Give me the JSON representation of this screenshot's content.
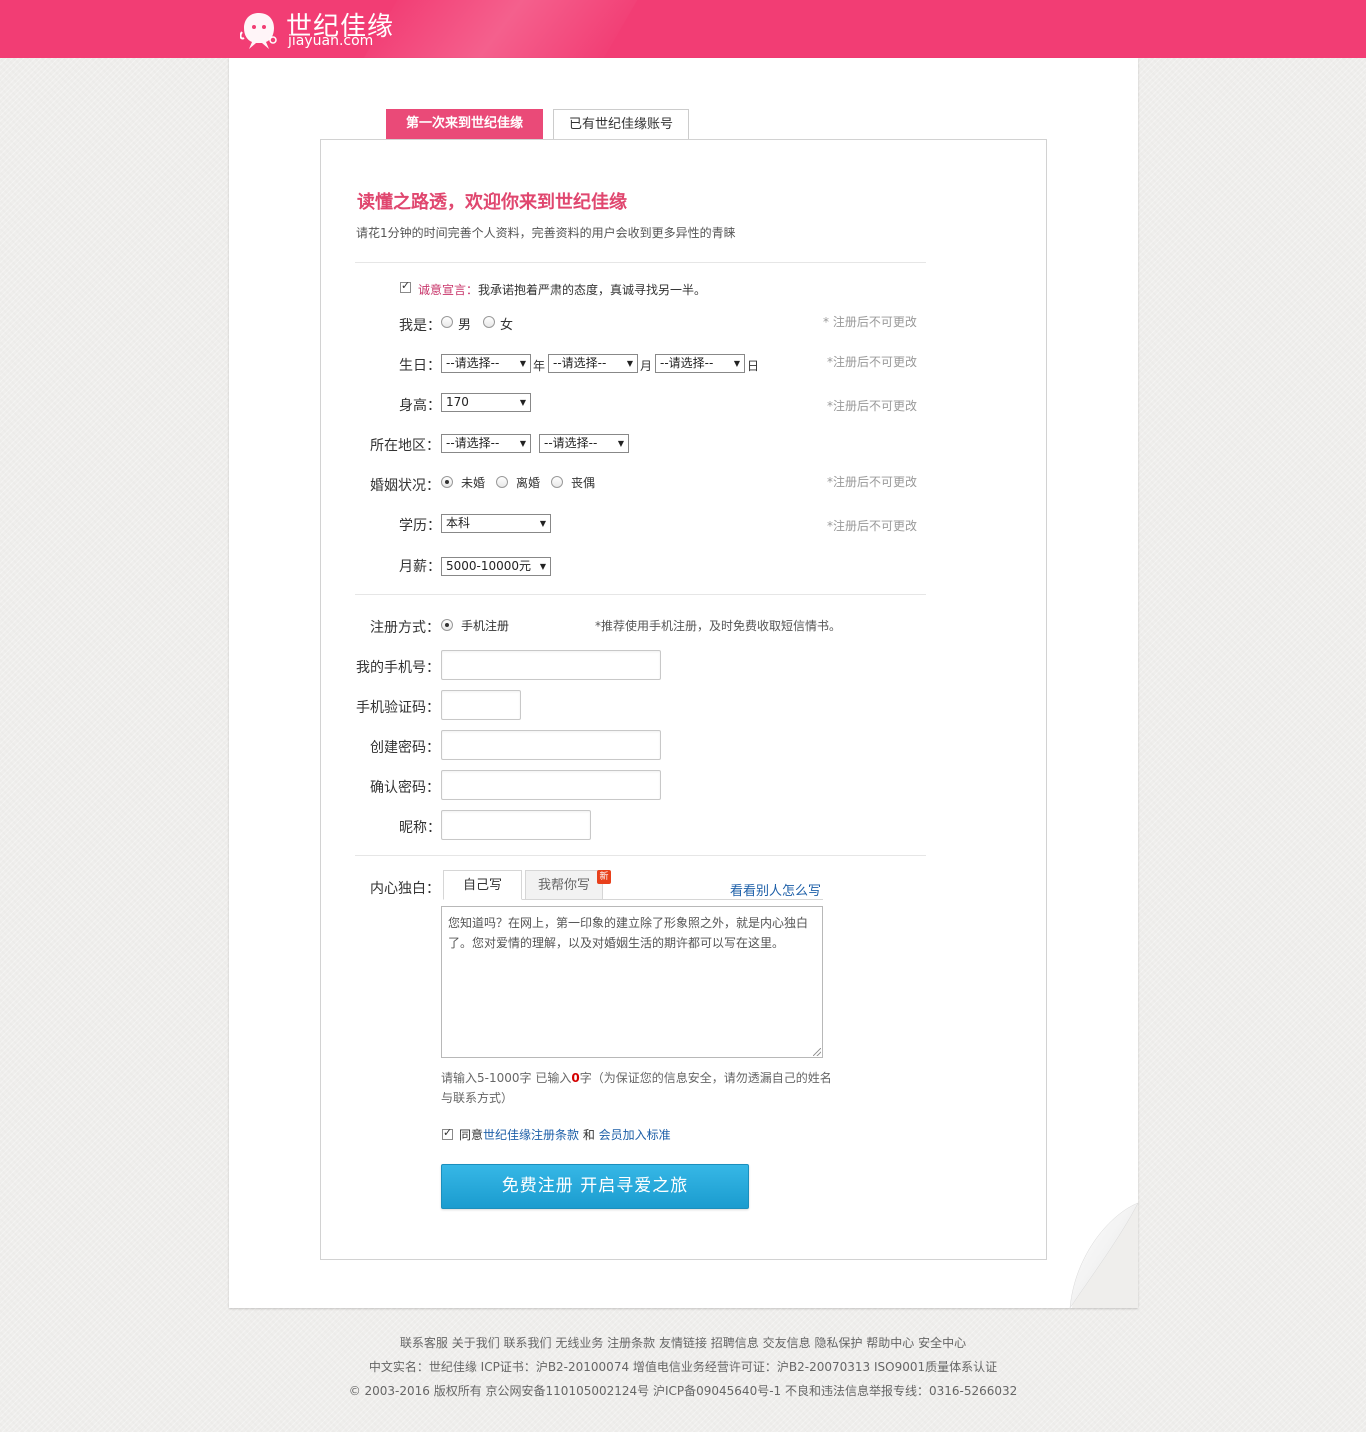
{
  "header": {
    "brand_cn": "世纪佳缘",
    "brand_en": "jiayuan.com",
    "colors": {
      "bar": "#f23d74",
      "accent": "#e0476f",
      "button": "#1b9ccf"
    }
  },
  "tabs": {
    "new_user": "第一次来到世纪佳缘",
    "existing_user": "已有世纪佳缘账号"
  },
  "intro": {
    "welcome": "读懂之路透，欢迎你来到世纪佳缘",
    "subtitle": "请花1分钟的时间完善个人资料，完善资料的用户会收到更多异性的青睐"
  },
  "pledge": {
    "title": "诚意宣言：",
    "text": "我承诺抱着严肃的态度，真诚寻找另一半。",
    "checked": true
  },
  "profile": {
    "gender": {
      "label": "我是：",
      "options": [
        "男",
        "女"
      ],
      "note": "* 注册后不可更改"
    },
    "birthday": {
      "label": "生日：",
      "year_placeholder": "--请选择--",
      "month_placeholder": "--请选择--",
      "day_placeholder": "--请选择--",
      "year_unit": "年",
      "month_unit": "月",
      "day_unit": "日",
      "note": "*注册后不可更改"
    },
    "height": {
      "label": "身高：",
      "value": "170",
      "note": "*注册后不可更改"
    },
    "region": {
      "label": "所在地区：",
      "province": "--请选择--",
      "city": "--请选择--"
    },
    "marriage": {
      "label": "婚姻状况：",
      "options": [
        "未婚",
        "离婚",
        "丧偶"
      ],
      "selected": "未婚",
      "note": "*注册后不可更改"
    },
    "education": {
      "label": "学历：",
      "value": "本科",
      "note": "*注册后不可更改"
    },
    "salary": {
      "label": "月薪：",
      "value": "5000-10000元"
    }
  },
  "account": {
    "method": {
      "label": "注册方式：",
      "option": "手机注册",
      "note": "*推荐使用手机注册，及时免费收取短信情书。"
    },
    "phone_label": "我的手机号：",
    "code_label": "手机验证码：",
    "password_label": "创建密码：",
    "confirm_label": "确认密码：",
    "nickname_label": "昵称："
  },
  "monologue": {
    "label": "内心独白：",
    "tab_self": "自己写",
    "tab_help": "我帮你写",
    "badge": "新",
    "see_others": "看看别人怎么写",
    "placeholder": "您知道吗？在网上，第一印象的建立除了形象照之外，就是内心独白了。您对爱情的理解，以及对婚姻生活的期许都可以写在这里。",
    "hint_prefix": "请输入5-1000字 已输入",
    "count": "0",
    "hint_suffix": "字（为保证您的信息安全，请勿透漏自己的姓名与联系方式）"
  },
  "terms": {
    "prefix": "同意",
    "terms_link": "世纪佳缘注册条款",
    "and": " 和 ",
    "standard_link": "会员加入标准",
    "checked": true
  },
  "submit": {
    "label": "免费注册  开启寻爱之旅"
  },
  "footer": {
    "links": "联系客服 关于我们 联系我们 无线业务 注册条款 友情链接 招聘信息 交友信息 隐私保护 帮助中心 安全中心",
    "license": "中文实名：世纪佳缘 ICP证书：沪B2-20100074 增值电信业务经营许可证：沪B2-20070313 ISO9001质量体系认证",
    "copyright": "© 2003-2016 版权所有  京公网安备110105002124号  沪ICP备09045640号-1  不良和违法信息举报专线：0316-5266032"
  }
}
